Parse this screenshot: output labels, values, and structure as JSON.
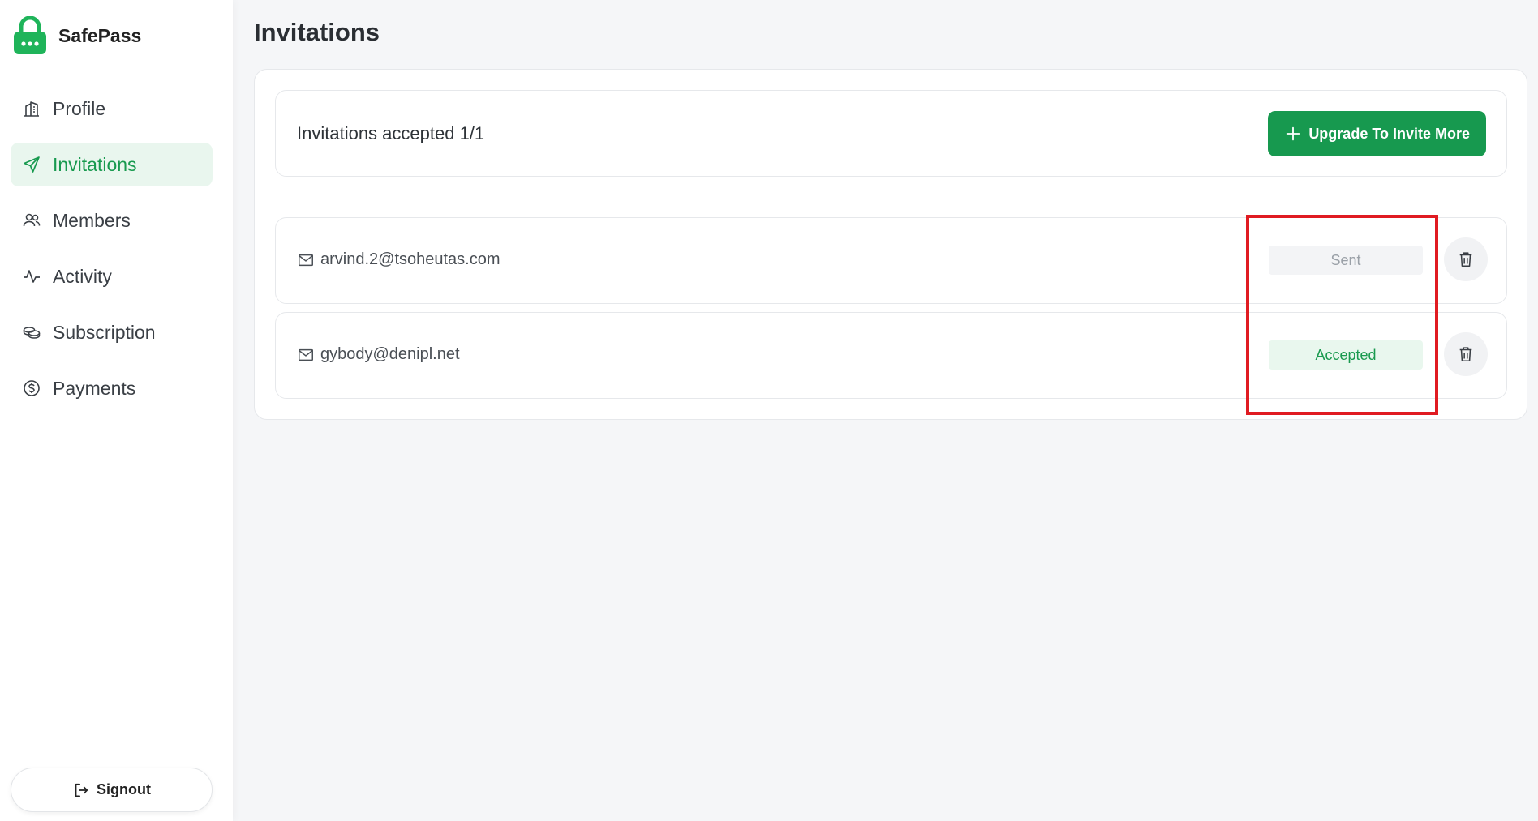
{
  "brand": {
    "name": "SafePass",
    "logo_icon": "lock-icon",
    "color": "#1fb45a"
  },
  "sidebar": {
    "items": [
      {
        "label": "Profile",
        "icon": "building-icon",
        "active": false
      },
      {
        "label": "Invitations",
        "icon": "send-icon",
        "active": true
      },
      {
        "label": "Members",
        "icon": "users-icon",
        "active": false
      },
      {
        "label": "Activity",
        "icon": "activity-icon",
        "active": false
      },
      {
        "label": "Subscription",
        "icon": "coins-icon",
        "active": false
      },
      {
        "label": "Payments",
        "icon": "dollar-circle-icon",
        "active": false
      }
    ],
    "signout_label": "Signout",
    "signout_icon": "logout-icon"
  },
  "main": {
    "title": "Invitations",
    "summary": "Invitations accepted 1/1",
    "upgrade_label": "Upgrade To Invite More",
    "upgrade_icon": "plus-icon",
    "invitations": [
      {
        "email": "arvind.2@tsoheutas.com",
        "status": "Sent"
      },
      {
        "email": "gybody@denipl.net",
        "status": "Accepted"
      }
    ]
  },
  "colors": {
    "accent": "#17994f",
    "active_bg": "#e9f6ee",
    "sent_bg": "#f3f4f6",
    "accepted_bg": "#e9f7ee",
    "highlight": "#e01b22"
  }
}
